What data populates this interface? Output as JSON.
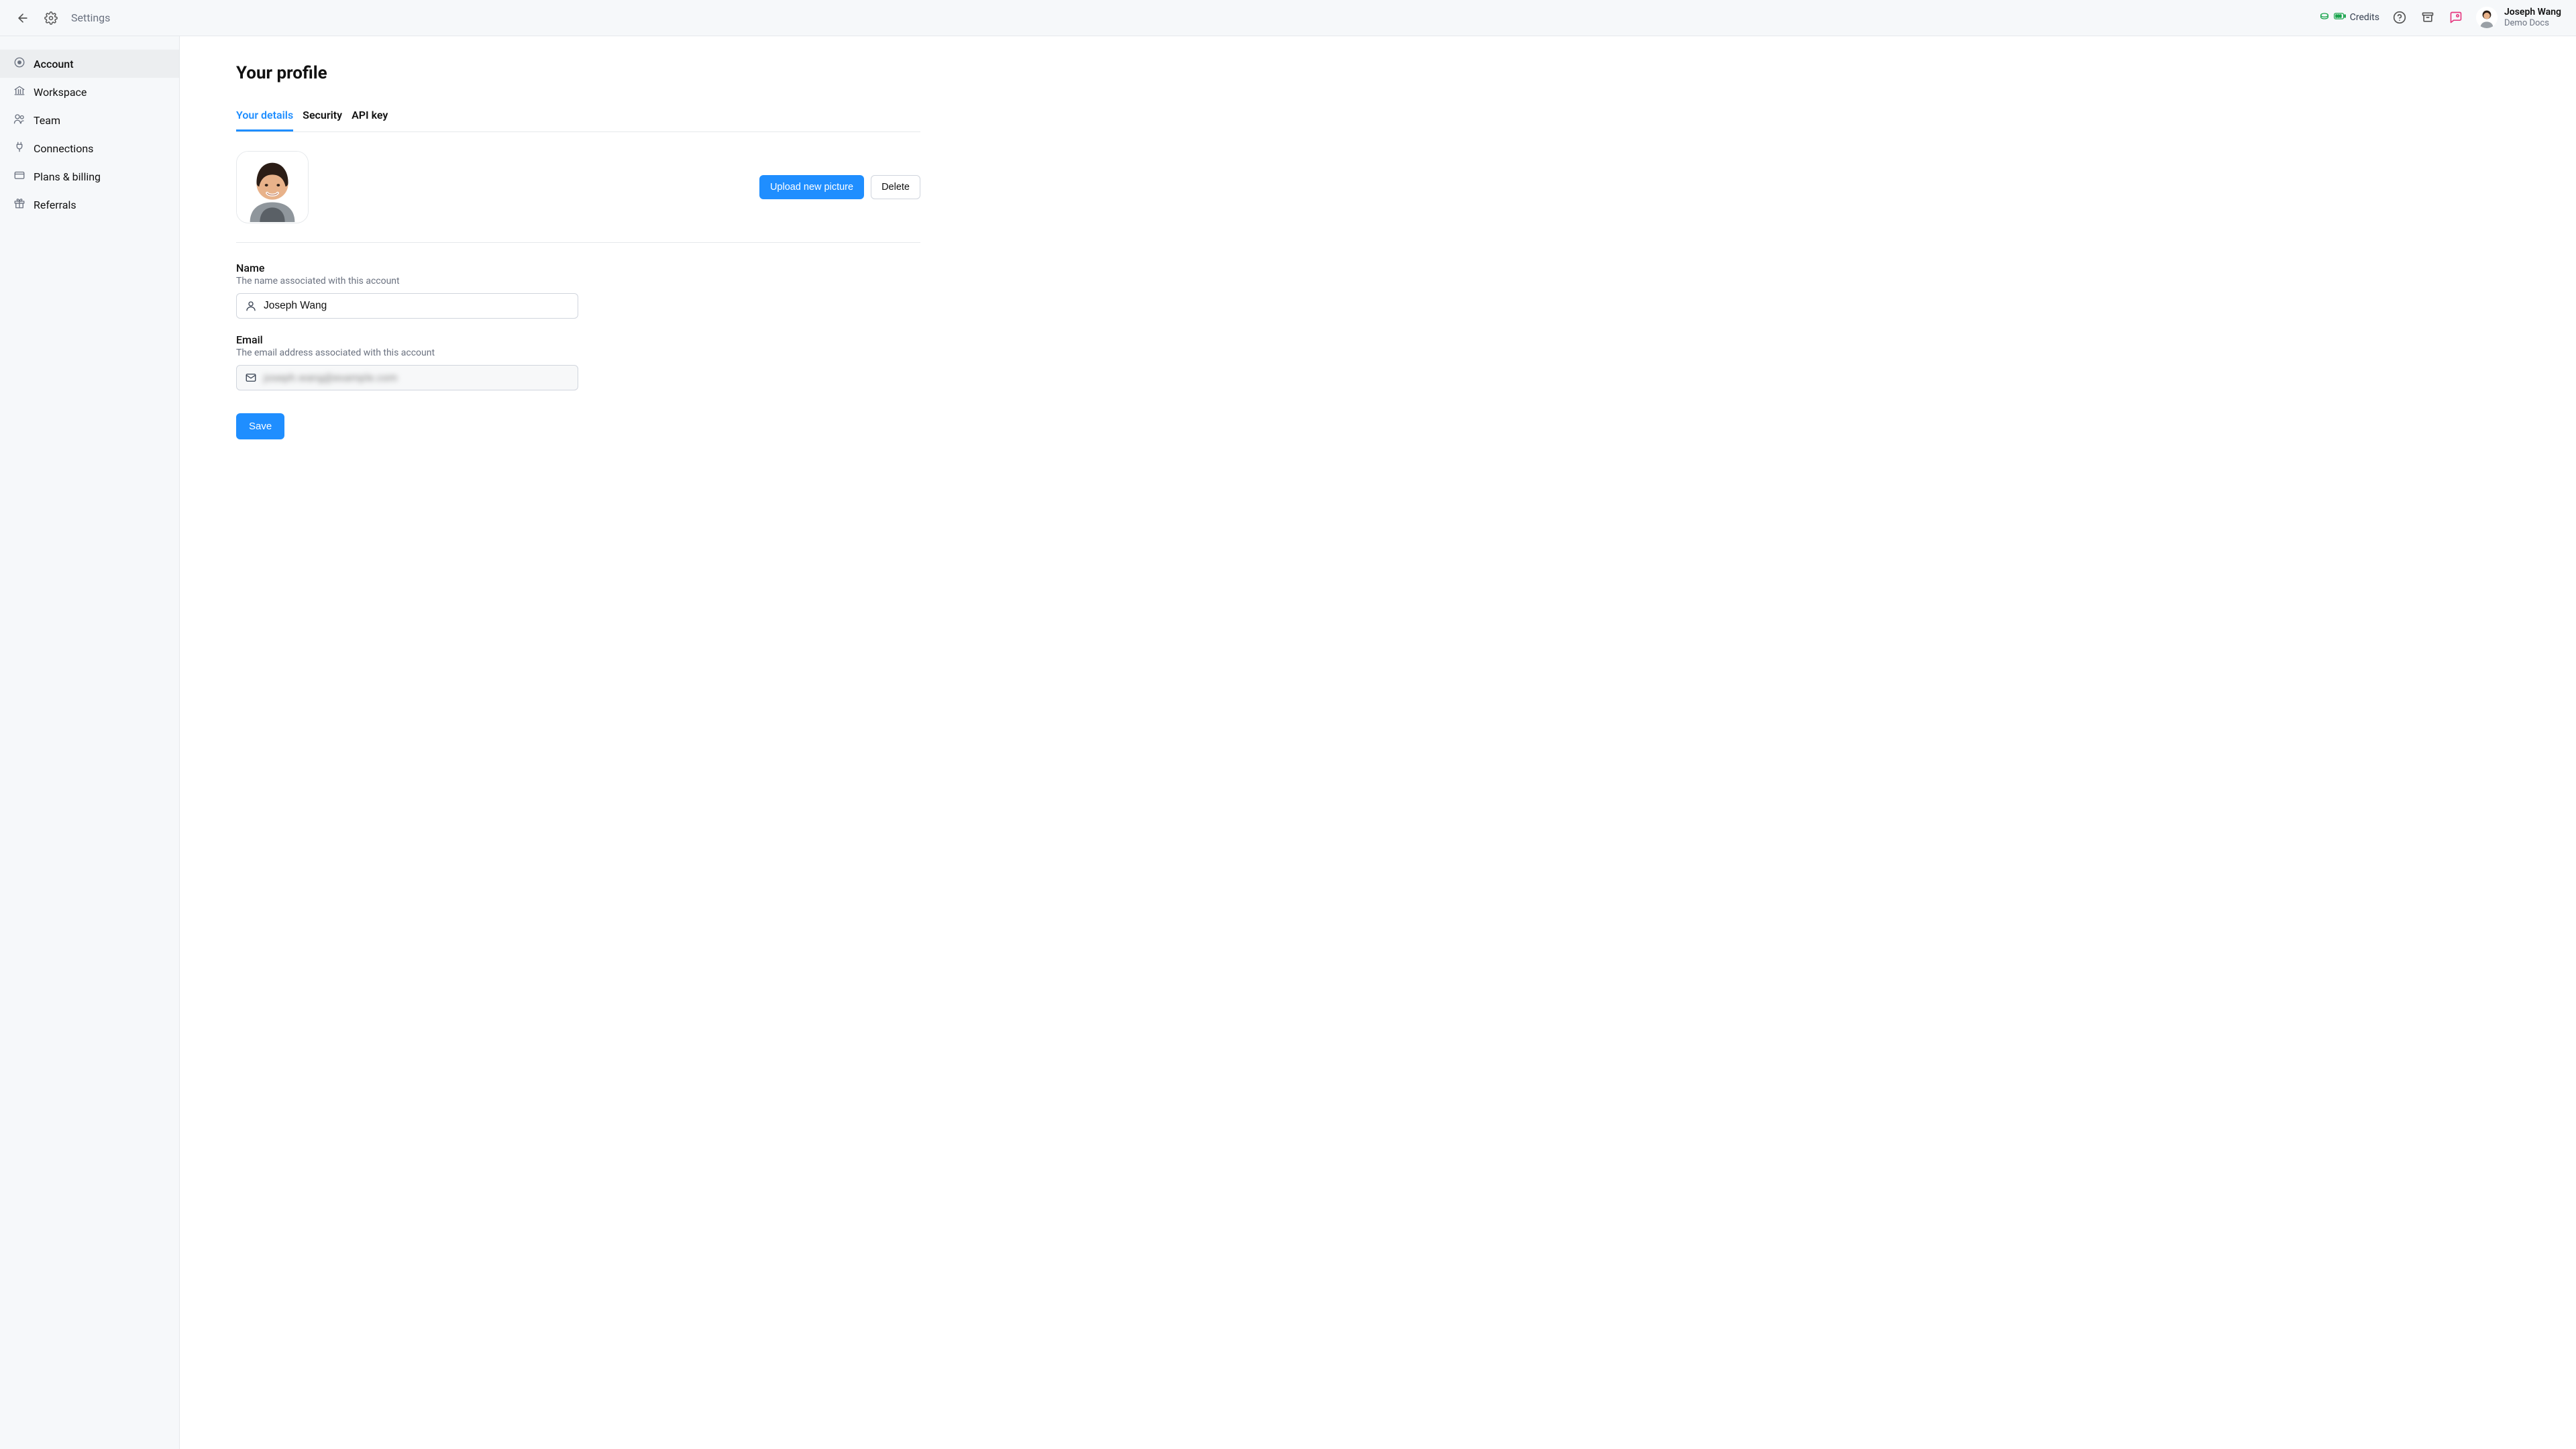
{
  "topbar": {
    "title": "Settings",
    "credits_label": "Credits",
    "profile_name": "Joseph Wang",
    "profile_sub": "Demo Docs"
  },
  "sidebar": {
    "items": [
      {
        "label": "Account",
        "icon": "target",
        "active": true
      },
      {
        "label": "Workspace",
        "icon": "bank",
        "active": false
      },
      {
        "label": "Team",
        "icon": "users",
        "active": false
      },
      {
        "label": "Connections",
        "icon": "plug",
        "active": false
      },
      {
        "label": "Plans & billing",
        "icon": "card",
        "active": false
      },
      {
        "label": "Referrals",
        "icon": "gift",
        "active": false
      }
    ]
  },
  "main": {
    "page_title": "Your profile",
    "tabs": [
      {
        "label": "Your details",
        "active": true
      },
      {
        "label": "Security",
        "active": false
      },
      {
        "label": "API key",
        "active": false
      }
    ],
    "upload_label": "Upload new picture",
    "delete_label": "Delete",
    "name": {
      "label": "Name",
      "desc": "The name associated with this account",
      "value": "Joseph Wang"
    },
    "email": {
      "label": "Email",
      "desc": "The email address associated with this account",
      "value_obscured": "joseph.wang@example.com"
    },
    "save_label": "Save"
  }
}
